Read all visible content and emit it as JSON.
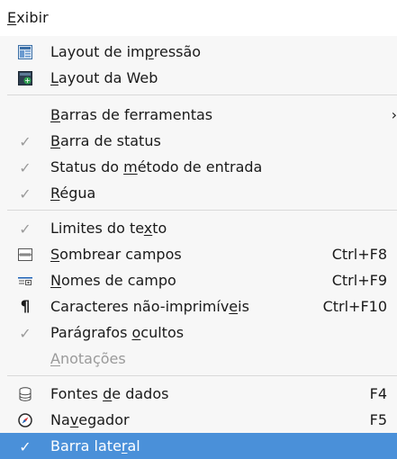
{
  "menu": {
    "title": "Exibir",
    "groups": [
      [
        {
          "label": "Layout de impressão",
          "icon": "print-layout-icon"
        },
        {
          "label": "Layout da Web",
          "icon": "web-layout-icon"
        }
      ],
      [
        {
          "label": "Barras de ferramentas",
          "submenu": "›"
        },
        {
          "label": "Barra de status",
          "checked": true
        },
        {
          "label": "Status do método de entrada",
          "checked": true
        },
        {
          "label": "Régua",
          "checked": true
        }
      ],
      [
        {
          "label": "Limites do texto",
          "checked": true
        },
        {
          "label": "Sombrear campos",
          "icon": "shade-fields-icon",
          "shortcut": "Ctrl+F8"
        },
        {
          "label": "Nomes de campo",
          "icon": "field-names-icon",
          "shortcut": "Ctrl+F9"
        },
        {
          "label": "Caracteres não-imprimíveis",
          "icon": "pilcrow-icon",
          "shortcut": "Ctrl+F10"
        },
        {
          "label": "Parágrafos ocultos",
          "checked": true
        },
        {
          "label": "Anotações",
          "disabled": true
        }
      ],
      [
        {
          "label": "Fontes de dados",
          "icon": "database-icon",
          "shortcut": "F4"
        },
        {
          "label": "Navegador",
          "icon": "navigator-icon",
          "shortcut": "F5"
        },
        {
          "label": "Barra lateral",
          "checked": true,
          "highlighted": true
        }
      ]
    ]
  },
  "colors": {
    "highlight": "#4a90d9",
    "check": "#9a9a9a",
    "disabled_text": "#9a9a9a"
  }
}
